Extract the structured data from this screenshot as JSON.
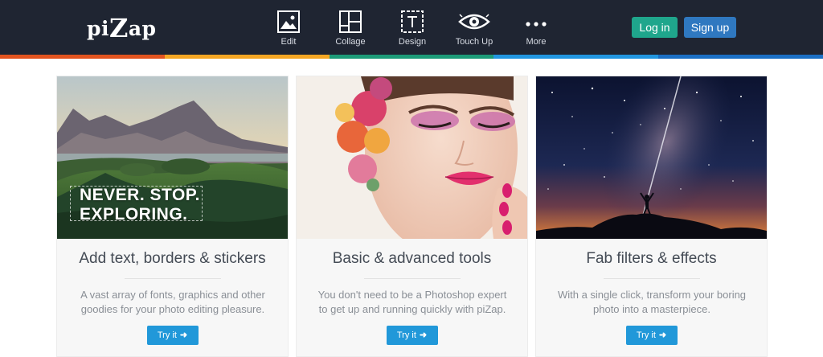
{
  "brand": {
    "logo_text_pre": "pi",
    "logo_text_big": "Z",
    "logo_text_post": "ap"
  },
  "nav": {
    "items": [
      {
        "label": "Edit",
        "icon": "image-icon"
      },
      {
        "label": "Collage",
        "icon": "collage-grid-icon"
      },
      {
        "label": "Design",
        "icon": "text-frame-icon"
      },
      {
        "label": "Touch Up",
        "icon": "eye-icon"
      },
      {
        "label": "More",
        "icon": "more-dots-icon"
      }
    ],
    "login_label": "Log in",
    "signup_label": "Sign up"
  },
  "colors": {
    "topbar_bg": "#1f2532",
    "login_bg": "#1fa68c",
    "signup_bg": "#2f78c0",
    "try_bg": "#2198d9",
    "stripe": [
      "#e2531e",
      "#f5a623",
      "#1c9b78",
      "#2196e0",
      "#1a6fc4"
    ]
  },
  "cards": [
    {
      "image_alt": "mountain-landscape",
      "overlay_line1": "NEVER. STOP.",
      "overlay_line2": "EXPLORING.",
      "title": "Add text, borders & stickers",
      "description": "A vast array of fonts, graphics and other goodies for your photo editing pleasure.",
      "button_label": "Try it"
    },
    {
      "image_alt": "makeup-portrait",
      "title": "Basic & advanced tools",
      "description": "You don't need to be a Photoshop expert to get up and running quickly with piZap.",
      "button_label": "Try it"
    },
    {
      "image_alt": "starry-night-sky",
      "title": "Fab filters & effects",
      "description": "With a single click, transform your boring photo into a masterpiece.",
      "button_label": "Try it"
    }
  ]
}
